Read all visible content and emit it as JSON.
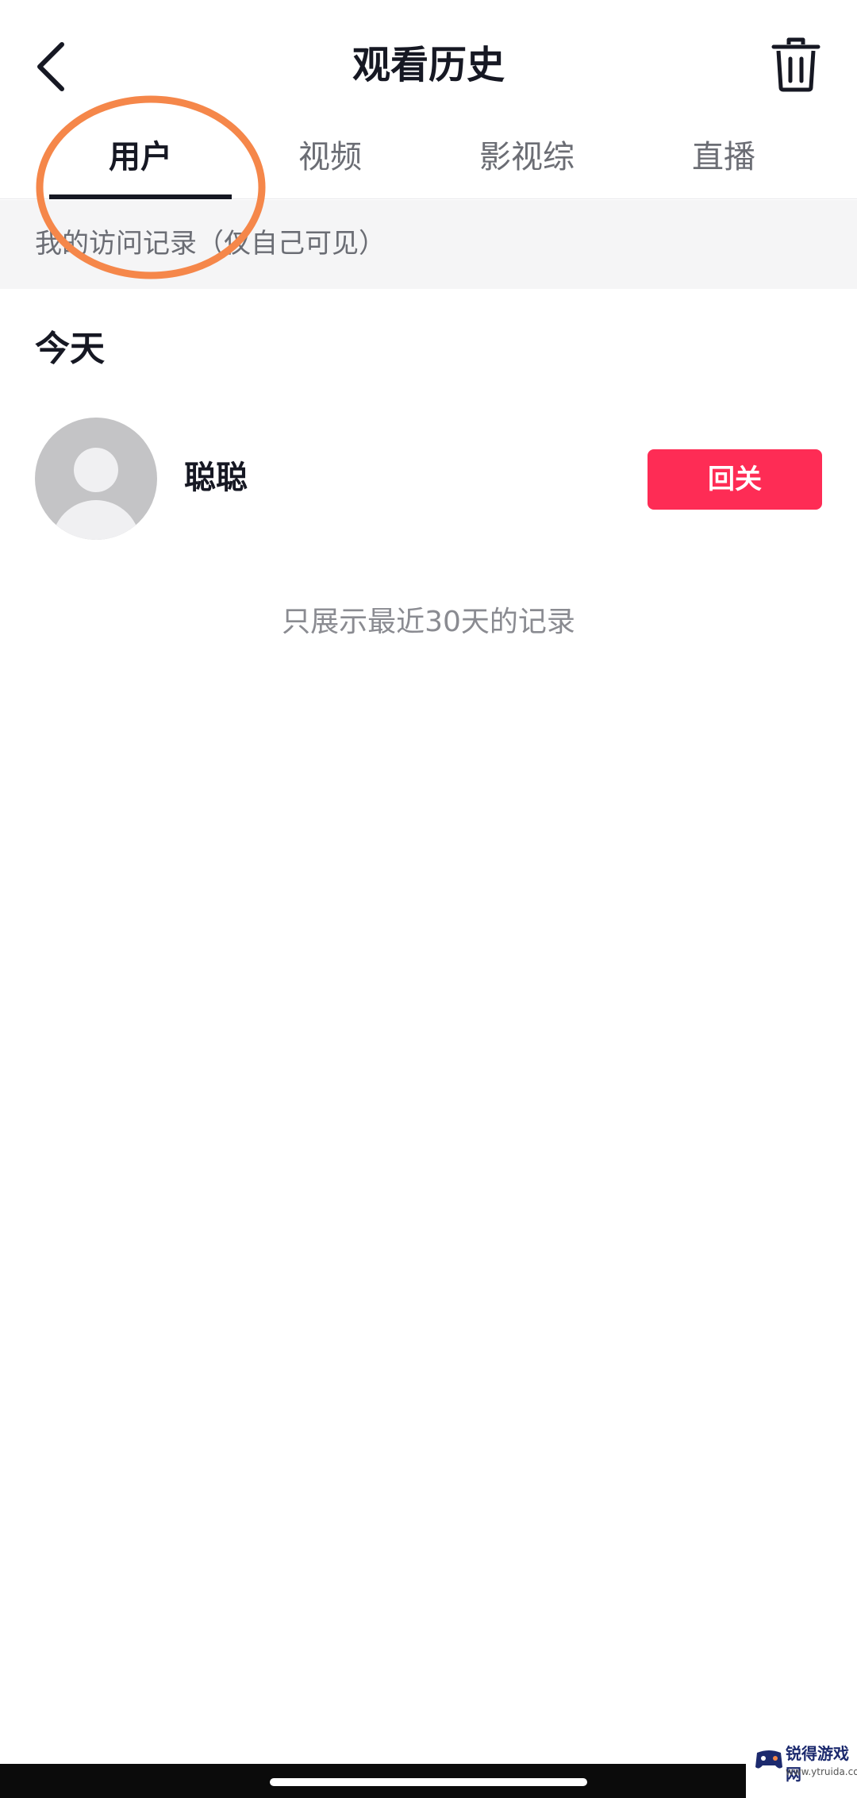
{
  "header": {
    "title": "观看历史",
    "back_icon": "chevron-left-icon",
    "trash_icon": "trash-icon"
  },
  "tabs": [
    {
      "label": "用户",
      "active": true
    },
    {
      "label": "视频",
      "active": false
    },
    {
      "label": "影视综",
      "active": false
    },
    {
      "label": "直播",
      "active": false
    }
  ],
  "hint": "我的访问记录（仅自己可见）",
  "section": {
    "title": "今天"
  },
  "users": [
    {
      "name": "聪聪",
      "action_label": "回关"
    }
  ],
  "footer_note": "只展示最近30天的记录",
  "watermark": {
    "name": "锐得游戏网",
    "url": "www.ytruida.com"
  },
  "colors": {
    "accent": "#fe2c55",
    "text_primary": "#161823",
    "text_secondary": "#6b6d74",
    "annotation": "#f5874a"
  }
}
